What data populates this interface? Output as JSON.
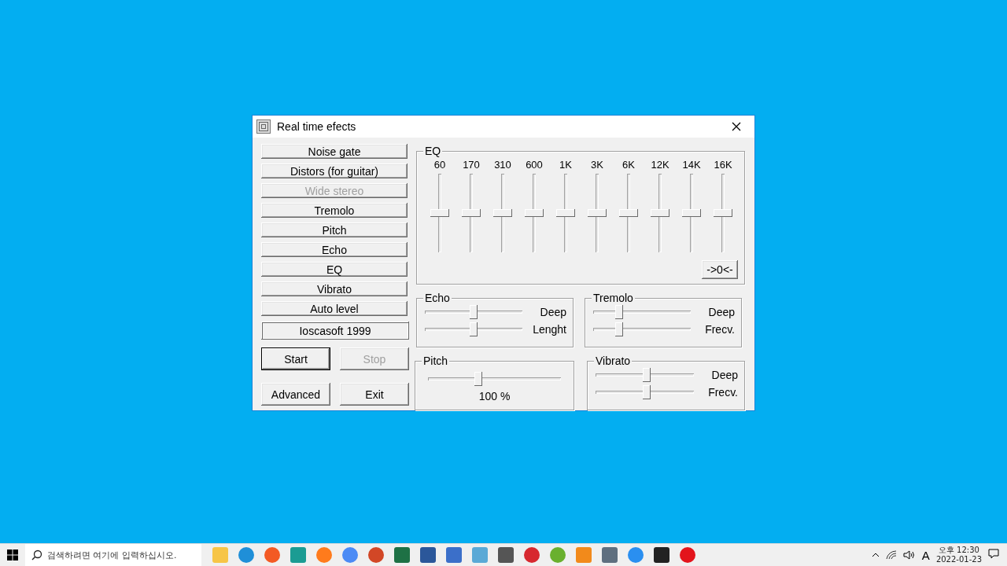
{
  "window": {
    "title": "Real time efects"
  },
  "effect_buttons": [
    {
      "label": "Noise gate",
      "disabled": false
    },
    {
      "label": "Distors (for guitar)",
      "disabled": false
    },
    {
      "label": "Wide stereo",
      "disabled": true
    },
    {
      "label": "Tremolo",
      "disabled": false
    },
    {
      "label": "Pitch",
      "disabled": false
    },
    {
      "label": "Echo",
      "disabled": false
    },
    {
      "label": "EQ",
      "disabled": false
    },
    {
      "label": "Vibrato",
      "disabled": false
    },
    {
      "label": "Auto level",
      "disabled": false
    }
  ],
  "credit": "Ioscasoft 1999",
  "control_buttons": [
    {
      "label": "Start",
      "disabled": false,
      "focused": true
    },
    {
      "label": "Stop",
      "disabled": true,
      "focused": false
    },
    {
      "label": "Advanced",
      "disabled": false,
      "focused": false
    },
    {
      "label": "Exit",
      "disabled": false,
      "focused": false
    }
  ],
  "eq": {
    "title": "EQ",
    "bands": [
      {
        "label": "60",
        "level": 0.5
      },
      {
        "label": "170",
        "level": 0.5
      },
      {
        "label": "310",
        "level": 0.5
      },
      {
        "label": "600",
        "level": 0.5
      },
      {
        "label": "1K",
        "level": 0.5
      },
      {
        "label": "3K",
        "level": 0.5
      },
      {
        "label": "6K",
        "level": 0.5
      },
      {
        "label": "12K",
        "level": 0.5
      },
      {
        "label": "14K",
        "level": 0.5
      },
      {
        "label": "16K",
        "level": 0.5
      }
    ],
    "reset_button": "->0<-"
  },
  "echo": {
    "title": "Echo",
    "sliders": [
      {
        "label": "Deep",
        "level": 0.5
      },
      {
        "label": "Lenght",
        "level": 0.5
      }
    ]
  },
  "tremolo": {
    "title": "Tremolo",
    "sliders": [
      {
        "label": "Deep",
        "level": 0.27
      },
      {
        "label": "Frecv.",
        "level": 0.27
      }
    ]
  },
  "pitch": {
    "title": "Pitch",
    "level": 0.38,
    "reading": "100 %"
  },
  "vibrato": {
    "title": "Vibrato",
    "sliders": [
      {
        "label": "Deep",
        "level": 0.52
      },
      {
        "label": "Frecv.",
        "level": 0.52
      }
    ]
  },
  "taskbar": {
    "search": {
      "placeholder": "검색하려면 여기에 입력하십시오."
    },
    "ime": "A",
    "time": "오후 12:30",
    "date": "2022-01-23"
  }
}
